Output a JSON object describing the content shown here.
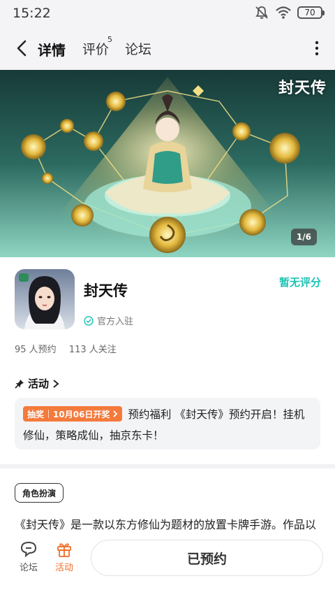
{
  "status": {
    "time": "15:22",
    "battery": "70"
  },
  "nav": {
    "detail": "详情",
    "review": "评价",
    "review_count": "5",
    "forum": "论坛"
  },
  "banner": {
    "brand": "封天传",
    "pager": "1/6"
  },
  "app": {
    "name": "封天传",
    "rating_text": "暂无评分",
    "official": "官方入驻",
    "reservations": "95 人预约",
    "followers": "113 人关注"
  },
  "activity": {
    "header": "活动",
    "badge_type": "抽奖",
    "badge_date": "10月06日开奖",
    "text_line1": "预约福利 《封天传》预约开启！挂机",
    "text_line2": "修仙，策略成仙，抽京东卡！"
  },
  "genre": "角色扮演",
  "description": "《封天传》是一款以东方修仙为题材的放置卡牌手游。作品以",
  "bottom": {
    "forum": "论坛",
    "activity": "活动",
    "reserve_button": "已预约"
  },
  "colors": {
    "accent": "#2fd1c5",
    "score": "#1cc3b6",
    "badge": "#f47a3c",
    "activity_active": "#f06d2b"
  },
  "icons": [
    "back-arrow-icon",
    "more-vertical-icon",
    "mute-bell-icon",
    "wifi-icon",
    "battery-icon",
    "verified-check-icon",
    "pin-icon",
    "chevron-right-icon",
    "forum-chat-icon",
    "gift-icon"
  ]
}
